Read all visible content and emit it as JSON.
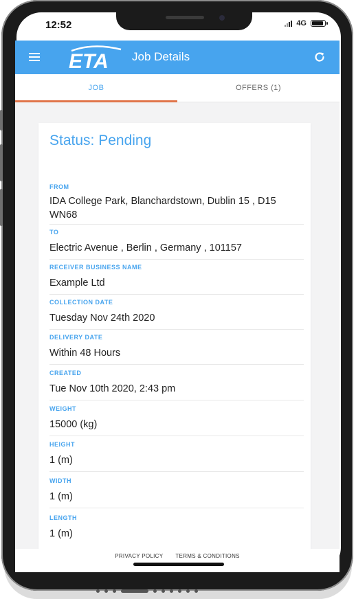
{
  "status_bar": {
    "time": "12:52",
    "network": "4G"
  },
  "app_bar": {
    "logo_text": "ETA",
    "title": "Job Details",
    "brand_color": "#47a4ee"
  },
  "tabs": [
    {
      "label": "JOB",
      "active": true
    },
    {
      "label": "OFFERS (1)",
      "active": false
    }
  ],
  "job": {
    "status": "Status: Pending",
    "fields": [
      {
        "label": "FROM",
        "value": "IDA College Park, Blanchardstown, Dublin 15 , D15 WN68"
      },
      {
        "label": "TO",
        "value": "Electric Avenue , Berlin , Germany , 101157"
      },
      {
        "label": "RECEIVER BUSINESS NAME",
        "value": "Example Ltd"
      },
      {
        "label": "COLLECTION DATE",
        "value": "Tuesday Nov 24th 2020"
      },
      {
        "label": "DELIVERY DATE",
        "value": "Within 48 Hours"
      },
      {
        "label": "CREATED",
        "value": "Tue Nov 10th 2020, 2:43 pm"
      },
      {
        "label": "WEIGHT",
        "value": "15000 (kg)"
      },
      {
        "label": "HEIGHT",
        "value": "1 (m)"
      },
      {
        "label": "WIDTH",
        "value": "1 (m)"
      },
      {
        "label": "LENGTH",
        "value": "1 (m)"
      }
    ]
  },
  "footer": {
    "privacy_label": "PRIVACY POLICY",
    "terms_label": "TERMS & CONDITIONS"
  },
  "icons": {
    "menu": "hamburger-menu-icon",
    "refresh": "refresh-icon"
  }
}
